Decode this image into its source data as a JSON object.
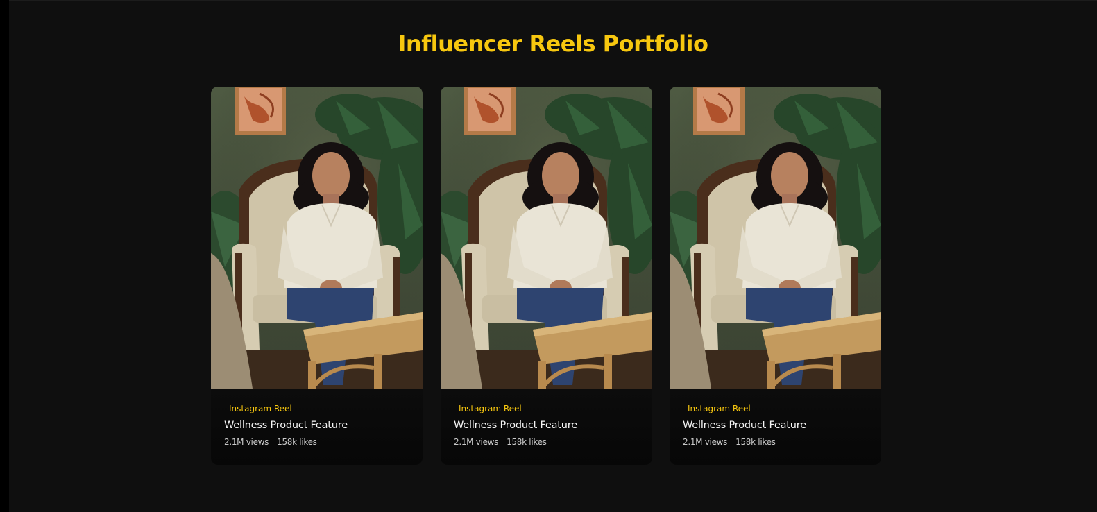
{
  "page": {
    "title": "Influencer Reels Portfolio"
  },
  "colors": {
    "accent": "#f7c70f",
    "background": "#0f0f0f",
    "card": "#121212"
  },
  "reels": [
    {
      "platform": "Instagram Reel",
      "title": "Wellness Product Feature",
      "views": "2.1M views",
      "likes": "158k likes",
      "thumbnail": "woman-seated-in-armchair-photo"
    },
    {
      "platform": "Instagram Reel",
      "title": "Wellness Product Feature",
      "views": "2.1M views",
      "likes": "158k likes",
      "thumbnail": "woman-seated-in-armchair-photo"
    },
    {
      "platform": "Instagram Reel",
      "title": "Wellness Product Feature",
      "views": "2.1M views",
      "likes": "158k likes",
      "thumbnail": "woman-seated-in-armchair-photo"
    }
  ]
}
